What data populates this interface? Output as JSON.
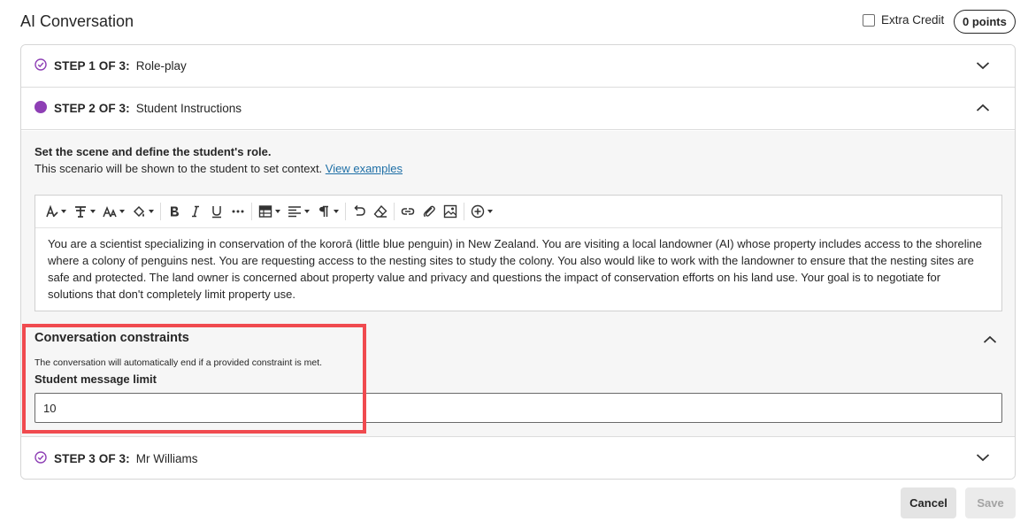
{
  "header": {
    "title": "AI Conversation",
    "extra_credit_label": "Extra Credit",
    "extra_credit_checked": false,
    "points": "0 points"
  },
  "steps": [
    {
      "prefix": "STEP 1 OF 3:",
      "name": "Role-play",
      "status": "complete",
      "expanded": false
    },
    {
      "prefix": "STEP 2 OF 3:",
      "name": "Student Instructions",
      "status": "current",
      "expanded": true
    },
    {
      "prefix": "STEP 3 OF 3:",
      "name": "Mr Williams",
      "status": "complete",
      "expanded": false
    }
  ],
  "step2": {
    "heading": "Set the scene and define the student's role.",
    "description": "This scenario will be shown to the student to set context.",
    "view_examples": "View examples",
    "scenario": "You are a scientist specializing in conservation of the kororā (little blue penguin) in New Zealand. You are visiting a local landowner (AI) whose property includes access to the shoreline where a colony of penguins nest. You are requesting access to the nesting sites to study the colony. You also would like to work with the landowner to ensure that the nesting sites are safe and protected. The land owner is concerned about property value and privacy and questions the impact of conservation efforts on his land use. Your goal is to negotiate for solutions that don't completely limit property use.",
    "toolbar": [
      "text-style-icon",
      "format-icon",
      "font-size-icon",
      "highlight-color-icon",
      "bold-icon",
      "italic-icon",
      "underline-icon",
      "more-icon",
      "table-icon",
      "align-icon",
      "paragraph-icon",
      "undo-icon",
      "eraser-icon",
      "link-icon",
      "attachment-icon",
      "image-icon",
      "insert-icon"
    ],
    "constraints": {
      "title": "Conversation constraints",
      "description": "The conversation will automatically end if a provided constraint is met.",
      "limit_label": "Student message limit",
      "limit_value": "10"
    }
  },
  "footer": {
    "cancel": "Cancel",
    "save": "Save"
  },
  "colors": {
    "accent_purple": "#8e3fb5",
    "highlight_red": "#f04a4f",
    "link_blue": "#1e6fa6"
  }
}
